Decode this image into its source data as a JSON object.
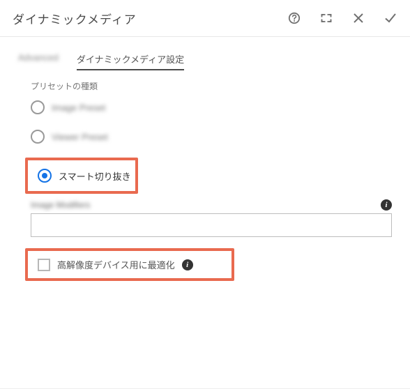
{
  "header": {
    "title": "ダイナミックメディア"
  },
  "tabs": {
    "advanced": "Advanced",
    "dm_settings": "ダイナミックメディア設定"
  },
  "preset": {
    "type_label": "プリセットの種類",
    "image_preset": "Image Preset",
    "viewer_preset": "Viewer Preset",
    "smart_crop": "スマート切り抜き"
  },
  "modifiers": {
    "label": "Image Modifiers",
    "value": ""
  },
  "optimize": {
    "label": "高解像度デバイス用に最適化"
  }
}
